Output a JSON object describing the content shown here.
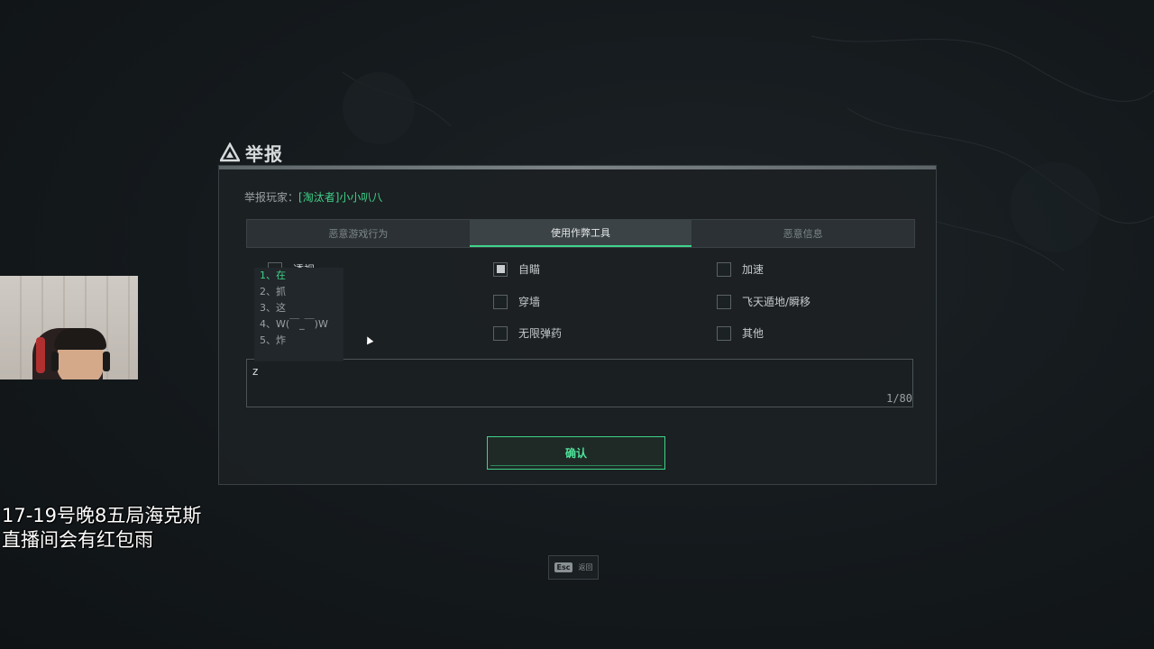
{
  "dialog": {
    "title": "举报",
    "reported_label": "举报玩家：",
    "reported_name": "[淘汰者]小小叭八",
    "tabs": [
      {
        "label": "恶意游戏行为",
        "active": false
      },
      {
        "label": "使用作弊工具",
        "active": true
      },
      {
        "label": "恶意信息",
        "active": false
      }
    ],
    "options": [
      {
        "label": "透视",
        "checked": false
      },
      {
        "label": "自瞄",
        "checked": true
      },
      {
        "label": "加速",
        "checked": false
      },
      {
        "label": "穿墙",
        "checked": false
      },
      {
        "label": "飞天遁地/瞬移",
        "checked": false
      },
      {
        "label": "无限弹药",
        "checked": false
      },
      {
        "label": "其他",
        "checked": false
      }
    ],
    "input_value": "z",
    "counter": "1/80",
    "confirm_label": "确认"
  },
  "ime": {
    "candidates": [
      "1、在",
      "2、抓",
      "3、这",
      "4、W(￣_￣)W",
      "5、炸"
    ],
    "selected_index": 0
  },
  "overlay_text": {
    "line1": "17-19号晚8五局海克斯",
    "line2": "直播间会有红包雨"
  },
  "footer": {
    "esc_key": "Esc",
    "esc_label": "返回"
  },
  "colors": {
    "accent": "#3fd38a",
    "background": "#14191c",
    "panel": "#1c2123"
  }
}
